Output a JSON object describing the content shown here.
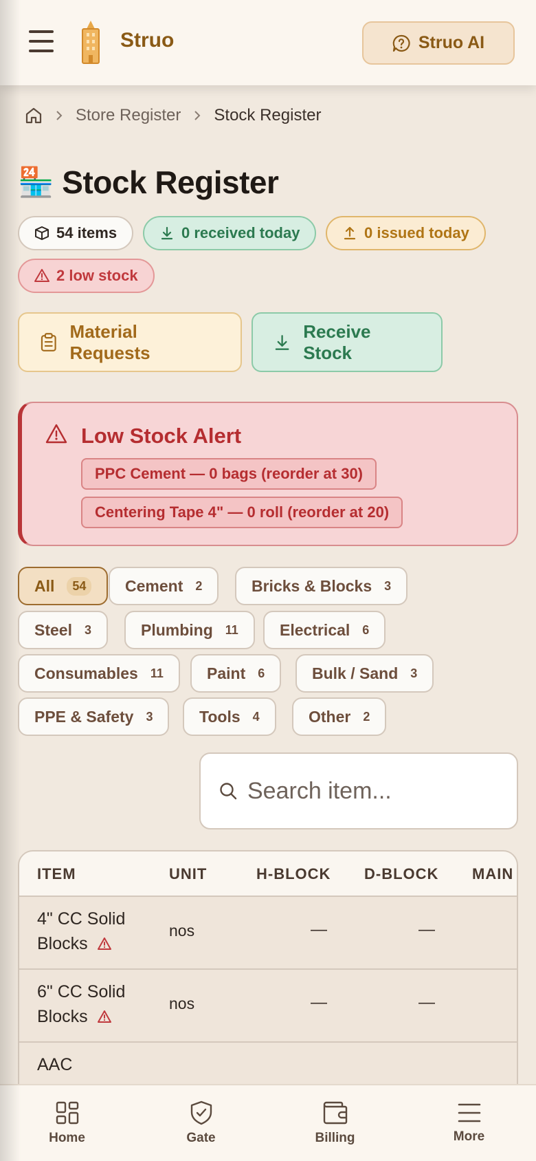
{
  "header": {
    "brand": "Struo",
    "ai_button_label": "Struo AI"
  },
  "breadcrumb": {
    "items": [
      "Store Register",
      "Stock Register"
    ]
  },
  "page": {
    "title_emoji": "🏪",
    "title": "Stock Register"
  },
  "stats": {
    "items": "54 items",
    "received": "0 received today",
    "issued": "0 issued today",
    "low_stock": "2 low stock"
  },
  "actions": {
    "material_requests": "Material Requests",
    "receive_stock": "Receive Stock"
  },
  "alert": {
    "title": "Low Stock Alert",
    "items": [
      "PPC Cement — 0 bags (reorder at 30)",
      "Centering Tape 4\" — 0 roll (reorder at 20)"
    ]
  },
  "filters": [
    {
      "label": "All",
      "count": "54"
    },
    {
      "label": "Cement",
      "count": "2"
    },
    {
      "label": "Bricks & Blocks",
      "count": "3"
    },
    {
      "label": "Steel",
      "count": "3"
    },
    {
      "label": "Plumbing",
      "count": "11"
    },
    {
      "label": "Electrical",
      "count": "6"
    },
    {
      "label": "Consumables",
      "count": "11"
    },
    {
      "label": "Paint",
      "count": "6"
    },
    {
      "label": "Bulk / Sand",
      "count": "3"
    },
    {
      "label": "PPE & Safety",
      "count": "3"
    },
    {
      "label": "Tools",
      "count": "4"
    },
    {
      "label": "Other",
      "count": "2"
    }
  ],
  "search": {
    "placeholder": "Search item..."
  },
  "table": {
    "headers": [
      "ITEM",
      "UNIT",
      "H-BLOCK",
      "D-BLOCK",
      "MAIN"
    ],
    "rows": [
      {
        "item_line1": "4\" CC Solid",
        "item_line2": "Blocks",
        "unit": "nos",
        "h_block": "—",
        "d_block": "—"
      },
      {
        "item_line1": "6\" CC Solid",
        "item_line2": "Blocks",
        "unit": "nos",
        "h_block": "—",
        "d_block": "—"
      },
      {
        "item_line1": "AAC",
        "item_line2": "",
        "unit": "",
        "h_block": "",
        "d_block": ""
      }
    ]
  },
  "bottom_nav": [
    {
      "label": "Home",
      "icon": "grid-icon"
    },
    {
      "label": "Gate",
      "icon": "shield-check-icon"
    },
    {
      "label": "Billing",
      "icon": "wallet-icon"
    },
    {
      "label": "More",
      "icon": "menu-icon"
    }
  ],
  "colors": {
    "brand": "#8a5a16",
    "success": "#2c7a50",
    "warning": "#b07515",
    "danger": "#c0393d",
    "background": "#f1e9df"
  }
}
